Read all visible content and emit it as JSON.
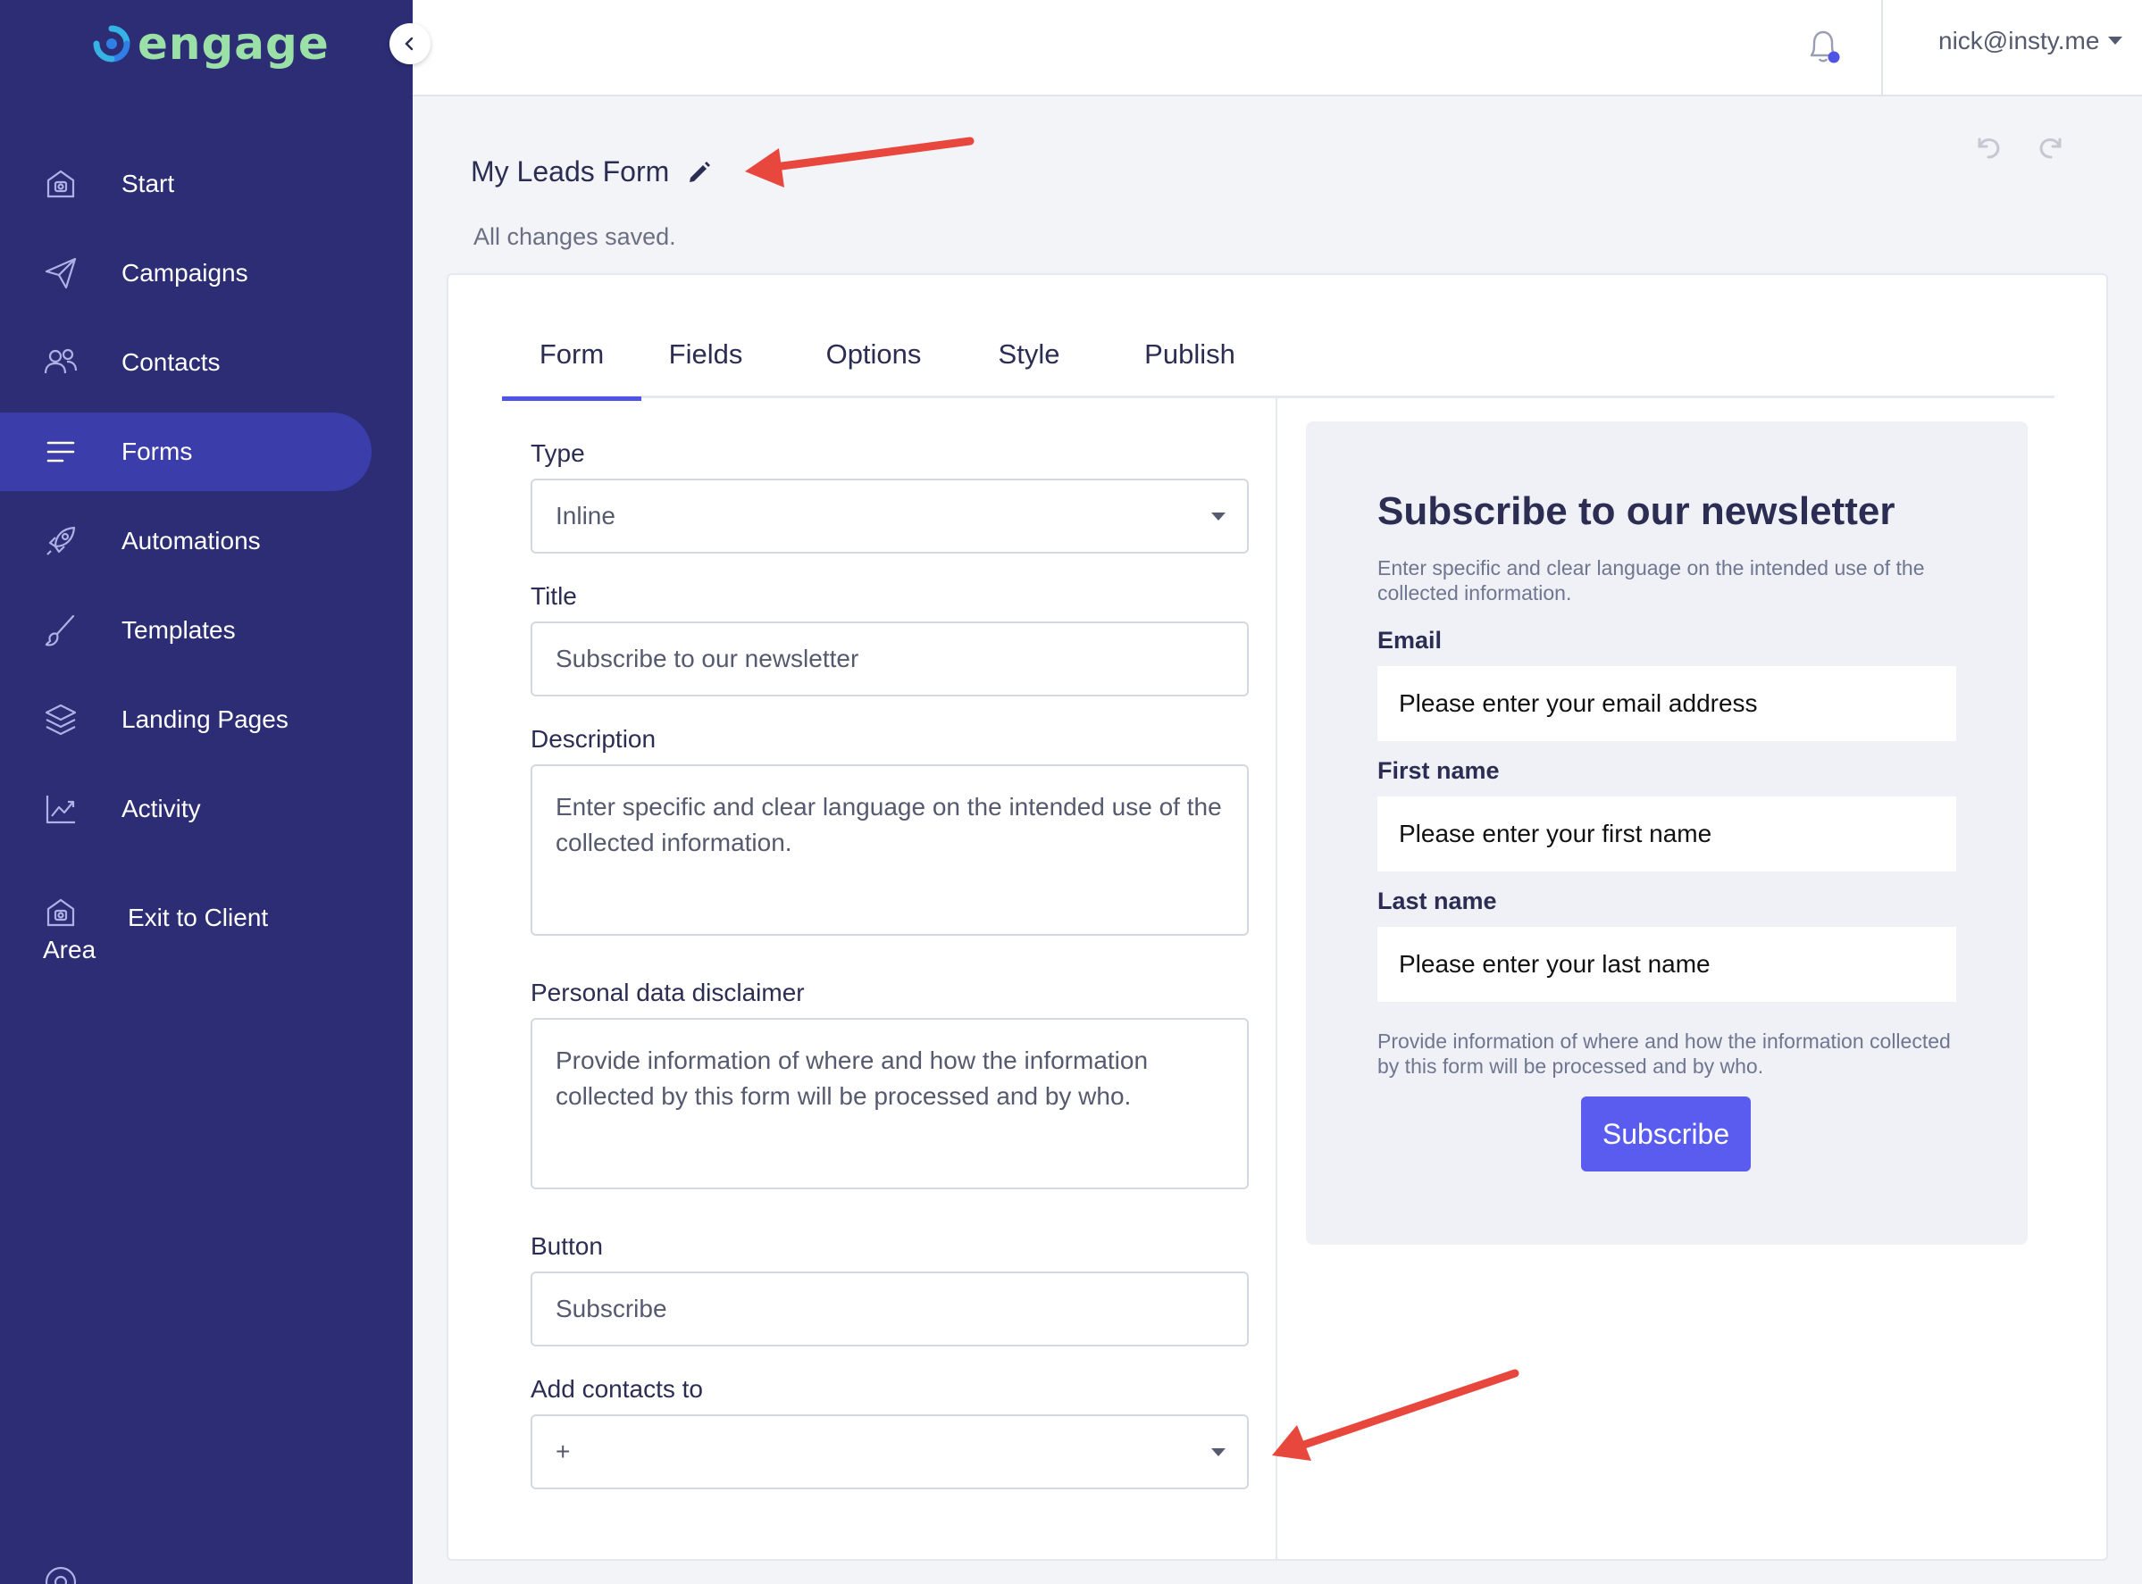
{
  "brand": {
    "name": "engage"
  },
  "sidebar": {
    "items": [
      {
        "label": "Start",
        "icon": "home-icon"
      },
      {
        "label": "Campaigns",
        "icon": "paper-plane-icon"
      },
      {
        "label": "Contacts",
        "icon": "users-icon"
      },
      {
        "label": "Forms",
        "icon": "list-icon",
        "active": true
      },
      {
        "label": "Automations",
        "icon": "rocket-icon"
      },
      {
        "label": "Templates",
        "icon": "brush-icon"
      },
      {
        "label": "Landing Pages",
        "icon": "layers-icon"
      },
      {
        "label": "Activity",
        "icon": "chart-icon"
      }
    ],
    "exit_line1": "Exit to Client",
    "exit_line2": "Area"
  },
  "topbar": {
    "user_email": "nick@insty.me"
  },
  "header": {
    "form_name": "My Leads Form",
    "save_status": "All changes saved."
  },
  "tabs": [
    "Form",
    "Fields",
    "Options",
    "Style",
    "Publish"
  ],
  "form": {
    "type_label": "Type",
    "type_value": "Inline",
    "title_label": "Title",
    "title_value": "Subscribe to our newsletter",
    "description_label": "Description",
    "description_value": "Enter specific and clear language on the intended use of the collected information.",
    "disclaimer_label": "Personal data disclaimer",
    "disclaimer_value": "Provide information of where and how the information collected by this form will be processed and by who.",
    "button_label": "Button",
    "button_value": "Subscribe",
    "add_contacts_label": "Add contacts to",
    "add_contacts_value": "+"
  },
  "preview": {
    "title": "Subscribe to our newsletter",
    "description": "Enter specific and clear language on the intended use of the collected information.",
    "email_label": "Email",
    "email_placeholder": "Please enter your email address",
    "first_name_label": "First name",
    "first_name_placeholder": "Please enter your first name",
    "last_name_label": "Last name",
    "last_name_placeholder": "Please enter your last name",
    "disclaimer": "Provide information of where and how the information collected by this form will be processed and by who.",
    "button": "Subscribe"
  },
  "colors": {
    "sidebar_bg": "#2c2d74",
    "active_nav": "#3a3daa",
    "accent": "#4f54e6",
    "preview_button": "#5a5cf0",
    "annotation_arrow": "#e8473d",
    "logo_green": "#9be0a6",
    "notification_dot": "#4f54e6"
  }
}
